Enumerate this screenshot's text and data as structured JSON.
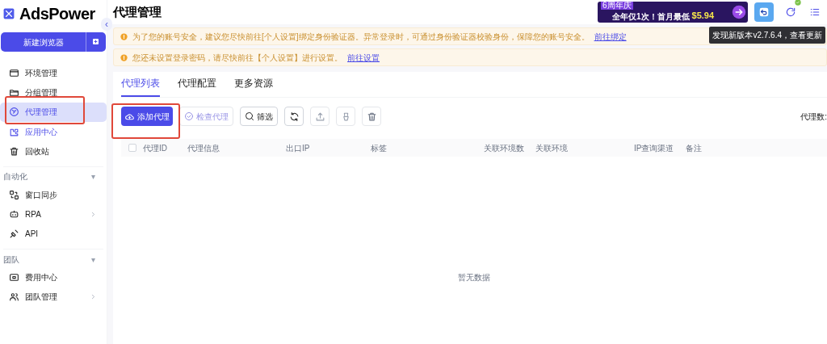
{
  "sidebar": {
    "logo": "AdsPower",
    "new_browser_button": "新建浏览器",
    "collapse_button": "‹",
    "sections": [
      {
        "items": [
          {
            "label": "环境管理",
            "selected": false,
            "accent": false,
            "has_submenu": false
          },
          {
            "label": "分组管理",
            "selected": false,
            "accent": false,
            "has_submenu": false
          },
          {
            "label": "代理管理",
            "selected": true,
            "accent": false,
            "has_submenu": false
          },
          {
            "label": "应用中心",
            "selected": false,
            "accent": true,
            "has_submenu": false
          },
          {
            "label": "回收站",
            "selected": false,
            "accent": false,
            "has_submenu": false
          }
        ]
      },
      {
        "header": "自动化",
        "caret": "▾",
        "items": [
          {
            "label": "窗口同步",
            "selected": false,
            "accent": false,
            "has_submenu": false
          },
          {
            "label": "RPA",
            "selected": false,
            "accent": false,
            "has_submenu": true
          },
          {
            "label": "API",
            "selected": false,
            "accent": false,
            "has_submenu": false
          }
        ]
      },
      {
        "header": "团队",
        "caret": "▾",
        "items": [
          {
            "label": "费用中心",
            "selected": false,
            "accent": false,
            "has_submenu": false
          },
          {
            "label": "团队管理",
            "selected": false,
            "accent": false,
            "has_submenu": true
          }
        ]
      }
    ]
  },
  "page_title": "代理管理",
  "promo": {
    "badge": "6周年庆",
    "text": "全年仅1次！首月最低",
    "price": "$5.94"
  },
  "tooltip": "发现新版本v2.7.6.4，查看更新",
  "notices": [
    {
      "text": "为了您的账号安全，建议您尽快前往[个人设置]绑定身份验证器。异常登录时，可通过身份验证器校验身份，保障您的账号安全。",
      "link": "前往绑定"
    },
    {
      "text": "您还未设置登录密码，请尽快前往【个人设置】进行设置。",
      "link": "前往设置"
    }
  ],
  "tabs": [
    {
      "label": "代理列表",
      "selected": true
    },
    {
      "label": "代理配置",
      "selected": false
    },
    {
      "label": "更多资源",
      "selected": false
    }
  ],
  "toolbar": {
    "add_button": "添加代理",
    "check_button": "检查代理",
    "filter_button": "筛选",
    "proxy_count": "代理数:"
  },
  "table": {
    "select_all_checked": false,
    "columns": [
      "代理ID",
      "代理信息",
      "出口IP",
      "标签",
      "关联环境数",
      "关联环境",
      "IP查询渠道",
      "备注"
    ],
    "empty_text": "暂无数据"
  }
}
